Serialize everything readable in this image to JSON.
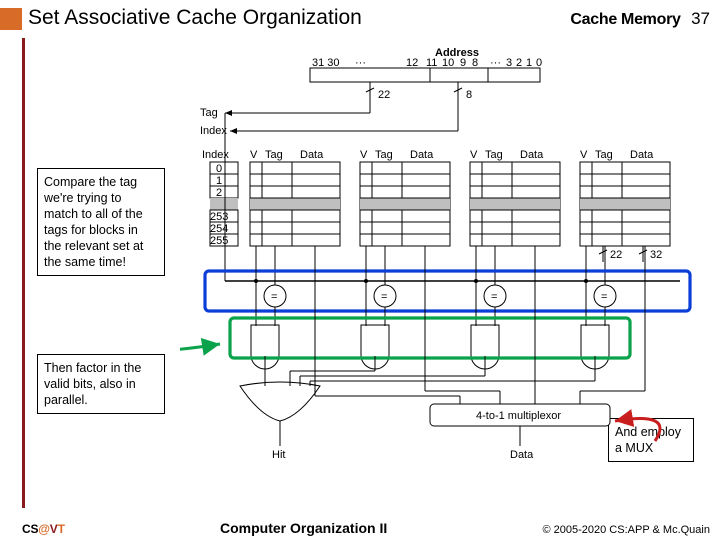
{
  "header": {
    "title": "Set Associative Cache Organization",
    "section": "Cache Memory",
    "page": "37"
  },
  "notes": {
    "n1": "Compare the tag we're trying to match to all of the tags for blocks in the relevant set at the same time!",
    "n2": "Then factor in the valid bits, also in parallel.",
    "n3": "And employ a MUX"
  },
  "diagram": {
    "labels": {
      "address": "Address",
      "tag": "Tag",
      "index": "Index",
      "v": "V",
      "tagcol": "Tag",
      "data": "Data",
      "hit": "Hit",
      "data_out": "Data",
      "mux": "4-to-1 multiplexor"
    },
    "bits": {
      "hi": "31 30",
      "dots": "···",
      "b12": "12",
      "b11": "11",
      "b10": "10",
      "b9": "9",
      "b8": "8",
      "dots2": "···",
      "b3": "3",
      "b2": "2",
      "b1": "1",
      "b0": "0"
    },
    "tag_width": "22",
    "idx_width": "8",
    "index_rows_top": [
      "0",
      "1",
      "2"
    ],
    "index_rows_bot": [
      "253",
      "254",
      "255"
    ],
    "set_tag_w": "22",
    "set_data_w": "32",
    "eq": "="
  },
  "footer": {
    "logo": {
      "c": "C",
      "s": "S",
      "at": "@",
      "v": "V",
      "t": "T"
    },
    "center": "Computer Organization II",
    "copyright": "© 2005-2020 CS:APP & Mc.Quain"
  }
}
